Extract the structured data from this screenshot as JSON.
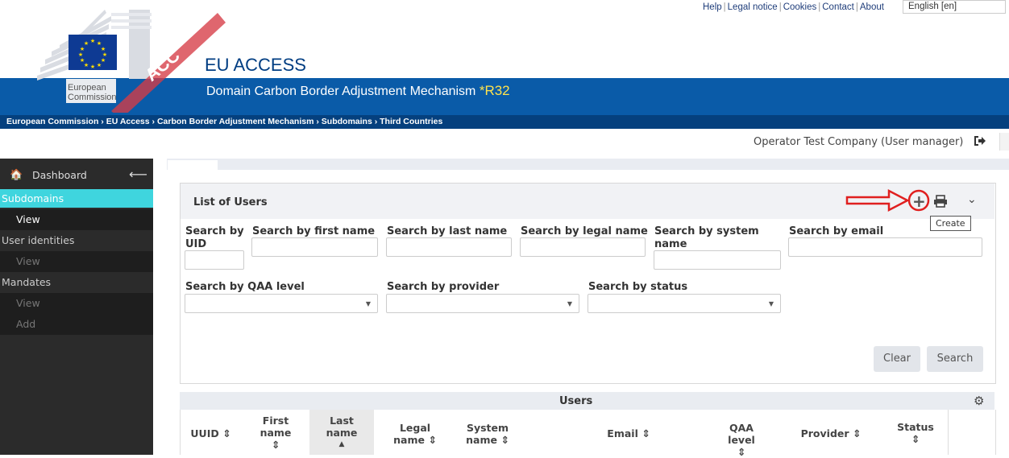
{
  "header": {
    "links": [
      "Help",
      "Legal notice",
      "Cookies",
      "Contact",
      "About"
    ],
    "language": "English [en]",
    "logo_text_line1": "European",
    "logo_text_line2": "Commission",
    "env_banner": "ACC",
    "app_title": "EU ACCESS",
    "app_subtitle": "Domain Carbon Border Adjustment Mechanism",
    "release": "*R32",
    "breadcrumb": [
      "European Commission",
      "EU Access",
      "Carbon Border Adjustment Mechanism",
      "Subdomains",
      "Third Countries"
    ],
    "user": "Operator Test Company (User manager)"
  },
  "sidebar": {
    "dashboard": "Dashboard",
    "items": [
      {
        "label": "Subdomains",
        "type": "section-active"
      },
      {
        "label": "View",
        "type": "sub-active"
      },
      {
        "label": "User identities",
        "type": "section"
      },
      {
        "label": "View",
        "type": "sub"
      },
      {
        "label": "Mandates",
        "type": "section"
      },
      {
        "label": "View",
        "type": "sub"
      },
      {
        "label": "Add",
        "type": "sub"
      }
    ]
  },
  "search_panel": {
    "title": "List of Users",
    "tooltip": "Create",
    "fields": {
      "uid": "Search by UID",
      "first_name": "Search by first name",
      "last_name": "Search by last name",
      "legal_name": "Search by legal name",
      "system_name": "Search by system name",
      "email": "Search by email",
      "qaa": "Search by QAA level",
      "provider": "Search by provider",
      "status": "Search by status"
    },
    "clear_label": "Clear",
    "search_label": "Search"
  },
  "users_table": {
    "title": "Users",
    "columns": [
      "UUID",
      "First name",
      "Last name",
      "Legal name",
      "System name",
      "Email",
      "QAA level",
      "Provider",
      "Status"
    ]
  },
  "colors": {
    "ribbon": "#0a5ba8",
    "breadcrumb_bar": "#05407e",
    "active_cyan": "#3fd5de",
    "annotation_red": "#e01f1f"
  }
}
